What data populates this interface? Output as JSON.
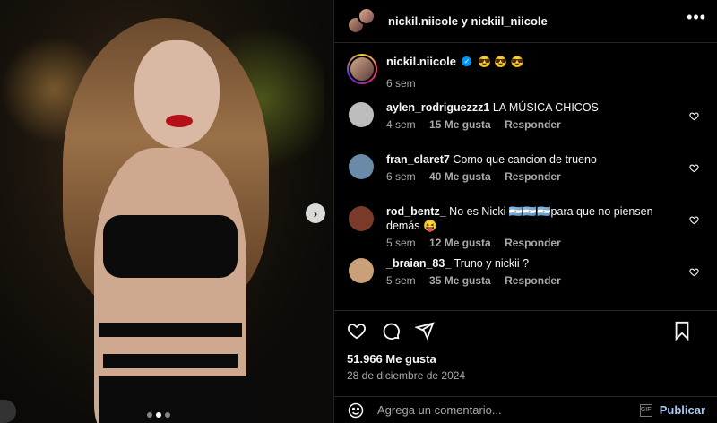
{
  "header": {
    "title": "nickil.niicole y nickiil_niicole",
    "more_icon": "more-horizontal-icon"
  },
  "caption": {
    "username": "nickil.niicole",
    "verified": true,
    "emojis": "😎 😎 😎",
    "age": "6 sem"
  },
  "comments": [
    {
      "username": "aylen_rodriguezzz1",
      "text": "LA MÚSICA CHICOS",
      "age": "4 sem",
      "likes": "15 Me gusta",
      "reply": "Responder",
      "avatar_color": "#bdbdbd"
    },
    {
      "username": "fran_claret7",
      "text": "Como que cancion de trueno",
      "age": "6 sem",
      "likes": "40 Me gusta",
      "reply": "Responder",
      "avatar_color": "#6a8aa8"
    },
    {
      "username": "rod_bentz_",
      "text": "No es Nicki 🇦🇷🇦🇷🇦🇷para que no piensen demás 😝",
      "age": "5 sem",
      "likes": "12 Me gusta",
      "reply": "Responder",
      "avatar_color": "#7a3a2a"
    },
    {
      "username": "_braian_83_",
      "text": "Truno y nickii ?",
      "age": "5 sem",
      "likes": "35 Me gusta",
      "reply": "Responder",
      "avatar_color": "#c9a077"
    }
  ],
  "actions": {
    "likes": "51.966 Me gusta",
    "date": "28 de diciembre de 2024"
  },
  "compose": {
    "placeholder": "Agrega un comentario...",
    "publish": "Publicar"
  },
  "carousel": {
    "current": 2,
    "total": 3
  },
  "colors": {
    "background": "#000000",
    "text": "#f5f5f5",
    "muted": "#a8a8a8",
    "verified": "#0095f6",
    "publish": "#a8c8f0"
  }
}
